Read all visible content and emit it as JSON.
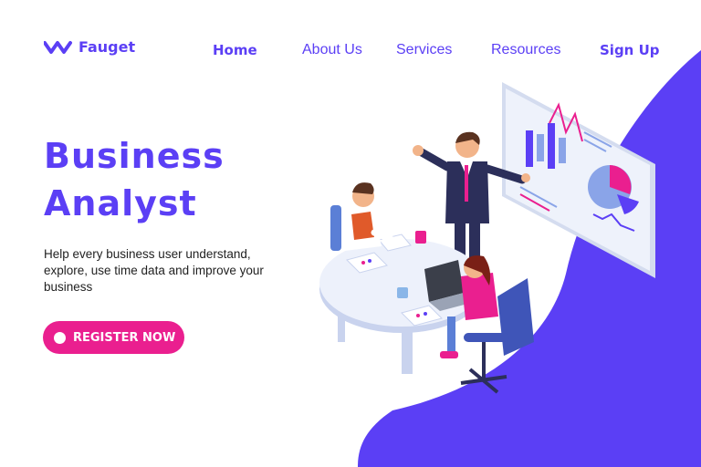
{
  "brand": {
    "name": "Fauget",
    "logo_icon": "double-chevron-wave-icon"
  },
  "nav": {
    "items": [
      {
        "label": "Home"
      },
      {
        "label": "About Us"
      },
      {
        "label": "Services"
      },
      {
        "label": "Resources"
      },
      {
        "label": "Sign Up"
      }
    ]
  },
  "hero": {
    "title_line1": "Business",
    "title_line2": "Analyst",
    "description": "Help every business user understand, explore, use time data and improve your business",
    "cta_label": "REGISTER NOW"
  },
  "colors": {
    "accent": "#5b3ff5",
    "cta": "#ea1f8f",
    "background": "#ffffff"
  },
  "illustration": {
    "subject": "business-meeting-analytics-illustration"
  }
}
